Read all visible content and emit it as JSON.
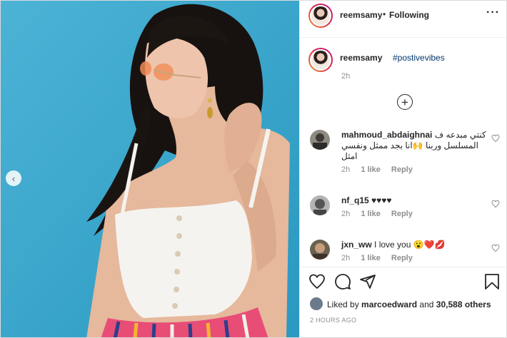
{
  "header": {
    "username": "reemsamy",
    "separator": "•",
    "follow_status": "Following",
    "more_icon": "more-horizontal-icon"
  },
  "caption": {
    "username": "reemsamy",
    "hashtag": "#postivevibes",
    "time": "2h"
  },
  "comments": [
    {
      "username": "mahmoud_abdaighnai",
      "text": "كنتي مبدعه ف المسلسل وربنا 🙌انا بجد ممثل ونفسي امثل",
      "time": "2h",
      "likes": "1 like",
      "reply": "Reply"
    },
    {
      "username": "nf_q15",
      "text": "♥♥♥♥",
      "time": "2h",
      "likes": "1 like",
      "reply": "Reply"
    },
    {
      "username": "jxn_ww",
      "text": "I love you 😮❤️💋",
      "time": "2h",
      "likes": "1 like",
      "reply": "Reply"
    }
  ],
  "likes": {
    "prefix": "Liked by",
    "user": "marcoedward",
    "joiner": "and",
    "others": "30,588 others"
  },
  "time_ago": "2 HOURS AGO",
  "icons": {
    "carousel_prev": "chevron-left-icon",
    "like": "heart-icon",
    "comment": "comment-icon",
    "share": "share-icon",
    "save": "bookmark-icon",
    "load_more": "plus-circle-icon"
  }
}
